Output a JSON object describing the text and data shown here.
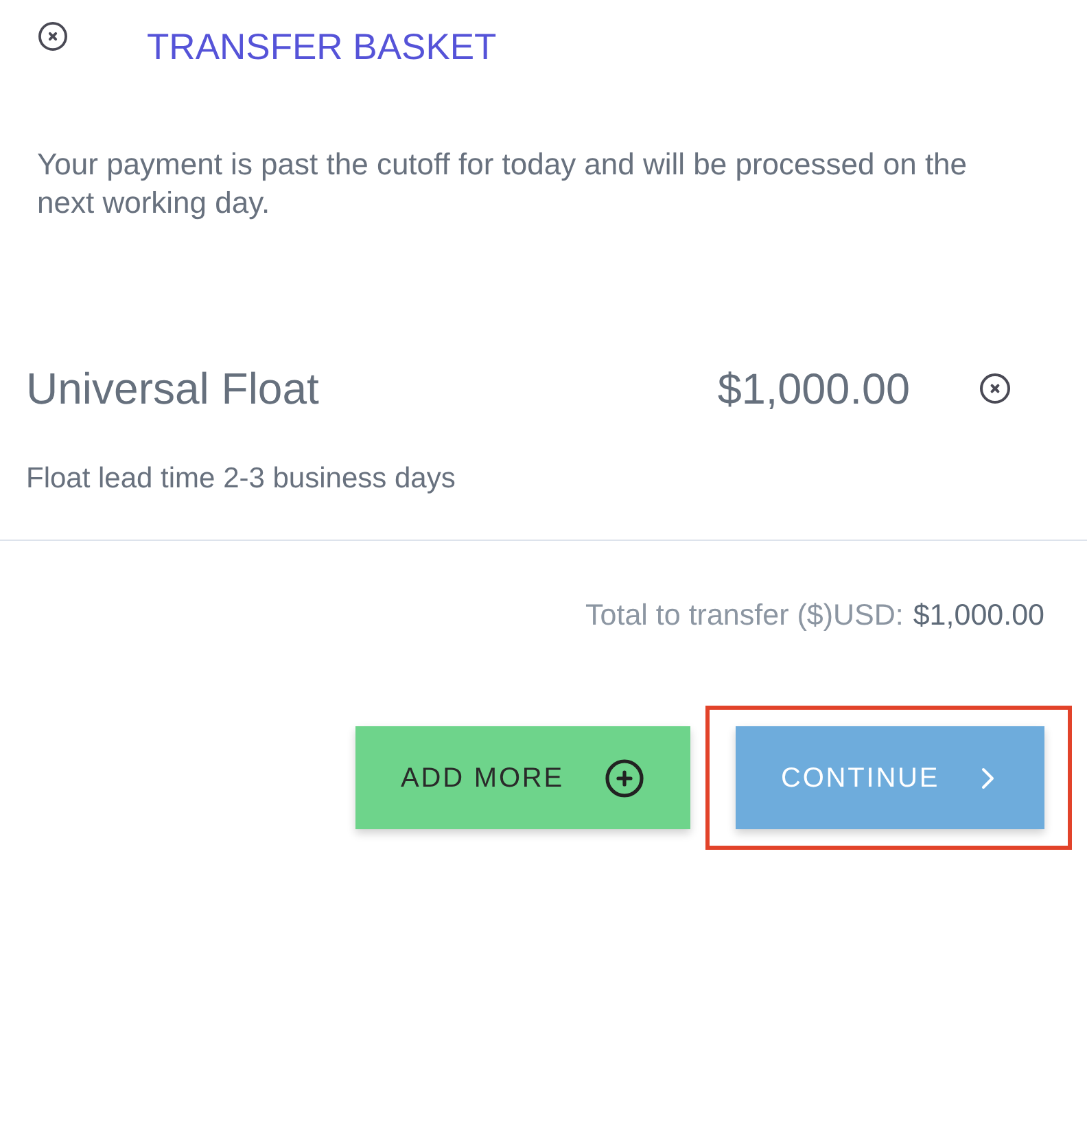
{
  "header": {
    "title": "TRANSFER BASKET"
  },
  "notice": "Your payment is past the cutoff for today and will be processed on the next working day.",
  "items": [
    {
      "name": "Universal Float",
      "amount": "$1,000.00",
      "note": "Float lead time 2-3 business days"
    }
  ],
  "total": {
    "label": "Total to transfer ($)USD:",
    "amount": "$1,000.00"
  },
  "actions": [
    {
      "kind": "add",
      "label": "ADD MORE",
      "highlighted": false
    },
    {
      "kind": "continue",
      "label": "CONTINUE",
      "highlighted": true
    }
  ]
}
